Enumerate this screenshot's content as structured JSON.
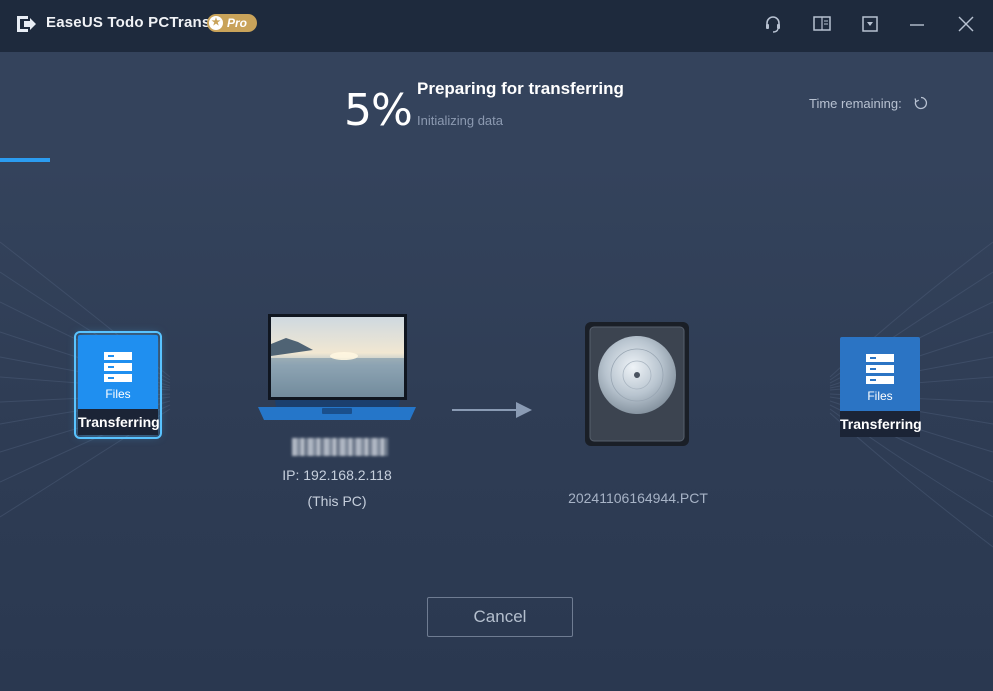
{
  "window": {
    "title": "EaseUS Todo PCTrans",
    "badge": "Pro",
    "icons": [
      "logo-icon",
      "headset-icon",
      "manual-icon",
      "dropdown-menu-icon",
      "minimize-icon",
      "close-icon"
    ]
  },
  "header": {
    "percent_text": "5%",
    "progress_fraction": 0.05,
    "status_title": "Preparing for transferring",
    "status_sub": "Initializing data",
    "time_remaining_label": "Time remaining:"
  },
  "source": {
    "card_type": "Files",
    "card_status": "Transferring",
    "ip": "IP: 192.168.2.118",
    "this_pc": "(This PC)"
  },
  "destination": {
    "file_name": "20241106164944.PCT",
    "card_type": "Files",
    "card_status": "Transferring"
  },
  "actions": {
    "cancel_label": "Cancel"
  },
  "colors": {
    "accent": "#2b9cf0",
    "titlebar": "#1e2a3d",
    "background": "#2c3a52",
    "badge": "#c9a35a"
  }
}
